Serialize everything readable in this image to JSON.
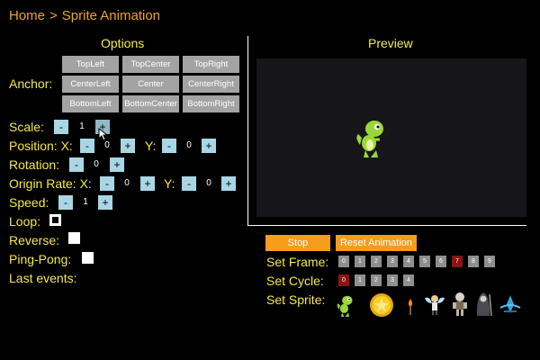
{
  "breadcrumb": {
    "home": "Home",
    "separator": ">",
    "current": "Sprite Animation"
  },
  "options": {
    "title": "Options",
    "anchor": {
      "label": "Anchor:",
      "buttons": [
        "TopLeft",
        "TopCenter",
        "TopRight",
        "CenterLeft",
        "Center",
        "CenterRight",
        "BottomLeft",
        "BottomCenter",
        "BottomRight"
      ]
    },
    "scale": {
      "label": "Scale:",
      "minus": "-",
      "value": "1",
      "plus": "+"
    },
    "position": {
      "label": "Position: X:",
      "x_value": "0",
      "y_label": "Y:",
      "y_value": "0",
      "minus": "-",
      "plus": "+"
    },
    "rotation": {
      "label": "Rotation:",
      "value": "0",
      "minus": "-",
      "plus": "+"
    },
    "origin_rate": {
      "label": "Origin Rate: X:",
      "x_value": "0",
      "y_label": "Y:",
      "y_value": "0",
      "minus": "-",
      "plus": "+"
    },
    "speed": {
      "label": "Speed:",
      "value": "1",
      "minus": "-",
      "plus": "+"
    },
    "loop": {
      "label": "Loop:",
      "checked": true
    },
    "reverse": {
      "label": "Reverse:",
      "checked": false
    },
    "ping_pong": {
      "label": "Ping-Pong:",
      "checked": false
    },
    "last_events": {
      "label": "Last events:"
    }
  },
  "preview": {
    "title": "Preview"
  },
  "controls": {
    "stop": "Stop",
    "reset": "Reset Animation",
    "set_frame": {
      "label": "Set Frame:",
      "values": [
        "0",
        "1",
        "2",
        "3",
        "4",
        "5",
        "6",
        "7",
        "8",
        "9"
      ],
      "selected": "7"
    },
    "set_cycle": {
      "label": "Set Cycle:",
      "values": [
        "0",
        "1",
        "2",
        "3",
        "4"
      ],
      "selected": "0"
    },
    "set_sprite": {
      "label": "Set Sprite:",
      "sprites": [
        "dino-sprite-icon",
        "gold-coin-sprite-icon",
        "torch-sprite-icon",
        "winged-angel-sprite-icon",
        "skeleton-warrior-sprite-icon",
        "dark-reaper-sprite-icon",
        "blue-crystal-sprite-icon"
      ]
    }
  },
  "colors": {
    "accent": "#f5e94a",
    "breadcrumb": "#f0a224",
    "button_orange": "#f59c1a",
    "selected_red": "#8b1313"
  }
}
